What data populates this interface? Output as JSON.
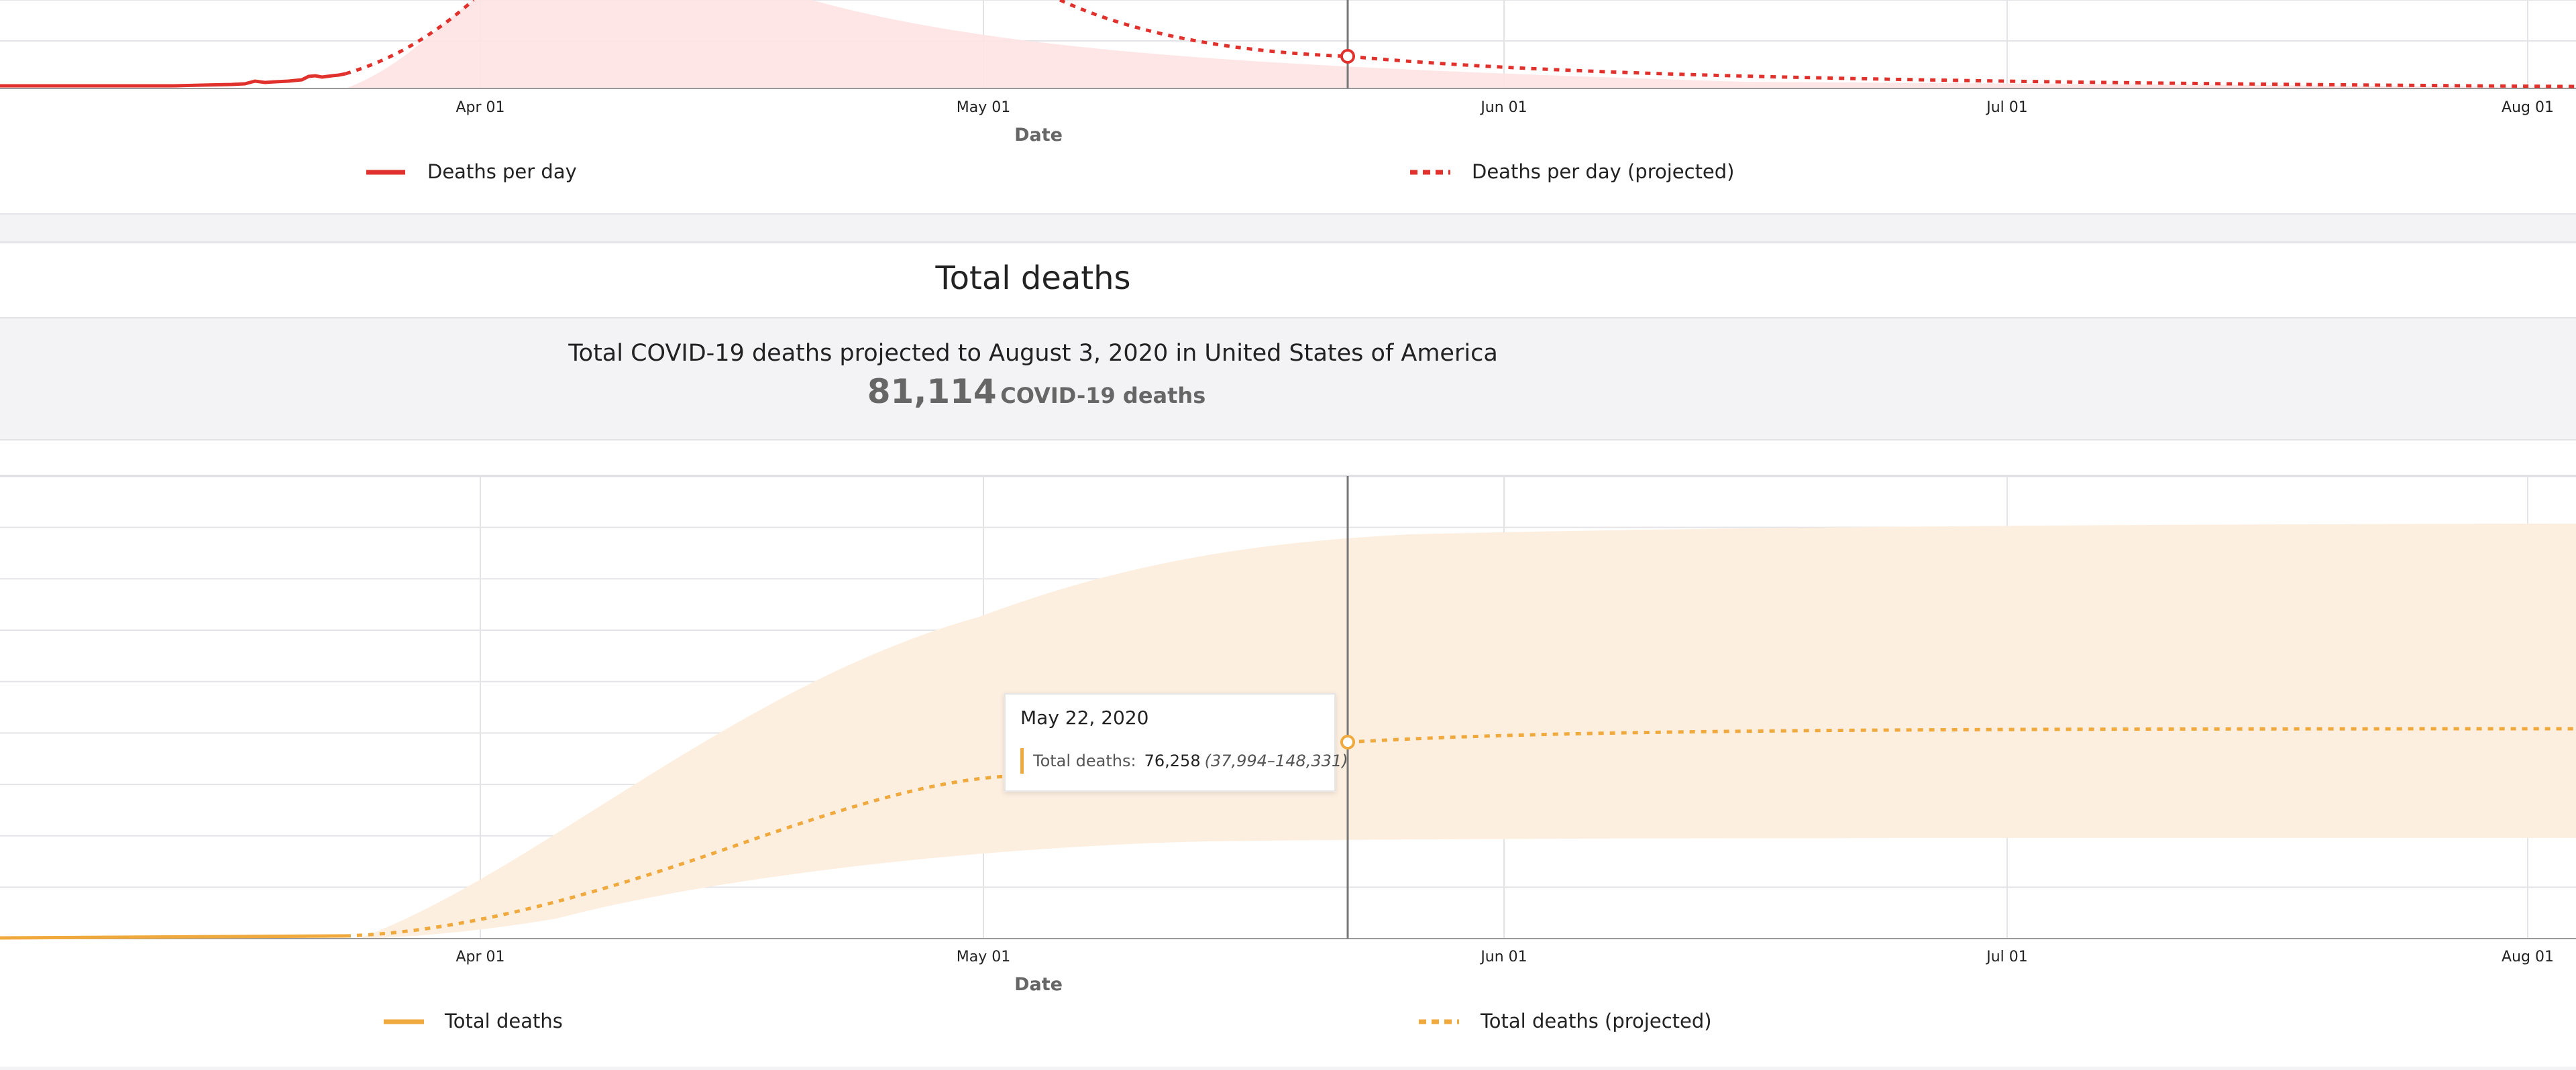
{
  "daily_card": {
    "xaxis_title": "Date",
    "legend": [
      {
        "label": "Deaths per day",
        "style": "solid"
      },
      {
        "label": "Deaths per day (projected)",
        "style": "dotted"
      }
    ]
  },
  "total_card": {
    "title": "Total deaths",
    "summary_text": "Total COVID-19 deaths projected to August 3, 2020 in United States of America",
    "summary_number": "81,114",
    "summary_unit": "COVID-19 deaths",
    "xaxis_title": "Date",
    "legend": [
      {
        "label": "Total deaths",
        "style": "solid"
      },
      {
        "label": "Total deaths (projected)",
        "style": "dotted"
      }
    ],
    "tooltip": {
      "date": "May 22, 2020",
      "label": "Total deaths:",
      "value": "76,258",
      "range": "(37,994–148,331)"
    }
  },
  "chart_data": [
    {
      "type": "line",
      "title": "",
      "xlabel": "Date",
      "x_ticks": [
        "Apr 01",
        "May 01",
        "Jun 01",
        "Jul 01",
        "Aug 01"
      ],
      "hover_date": "2020-05-22",
      "colors": {
        "line": "#e0312d",
        "band": "#fde3e2"
      },
      "series": [
        {
          "name": "Deaths per day",
          "style": "solid"
        },
        {
          "name": "Deaths per day (projected)",
          "style": "dotted"
        }
      ]
    },
    {
      "type": "line",
      "title": "Total deaths",
      "xlabel": "Date",
      "x_ticks": [
        "Apr 01",
        "May 01",
        "Jun 01",
        "Jul 01",
        "Aug 01"
      ],
      "hover_date": "2020-05-22",
      "colors": {
        "line": "#f0a93c",
        "band": "#fdefe0"
      },
      "series": [
        {
          "name": "Total deaths",
          "style": "solid"
        },
        {
          "name": "Total deaths (projected)",
          "style": "dotted"
        }
      ],
      "hover_point": {
        "date": "2020-05-22",
        "value": 76258,
        "lower": 37994,
        "upper": 148331
      }
    }
  ]
}
